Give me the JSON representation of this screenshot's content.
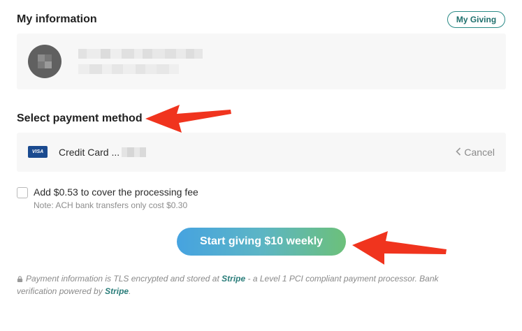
{
  "header": {
    "title": "My information",
    "my_giving_label": "My Giving"
  },
  "payment": {
    "title": "Select payment method",
    "card_brand": "VISA",
    "card_label": "Credit Card ...",
    "cancel_label": "Cancel"
  },
  "fee": {
    "label": "Add $0.53 to cover the processing fee",
    "note": "Note: ACH bank transfers only cost $0.30",
    "checked": false
  },
  "cta": {
    "label": "Start giving $10 weekly"
  },
  "footer": {
    "text_1": "Payment information is TLS encrypted and stored at ",
    "stripe_1": "Stripe",
    "text_2": " - a Level 1 PCI compliant payment processor. Bank verification powered by ",
    "stripe_2": "Stripe",
    "text_3": "."
  },
  "colors": {
    "accent_teal": "#2a8a86",
    "arrow_red": "#f0341e",
    "visa_blue": "#1a4a8f"
  },
  "icons": {
    "lock": "lock-icon",
    "chevron": "chevron-left-icon",
    "card": "visa-card-icon",
    "arrow": "red-pointer-arrow"
  }
}
